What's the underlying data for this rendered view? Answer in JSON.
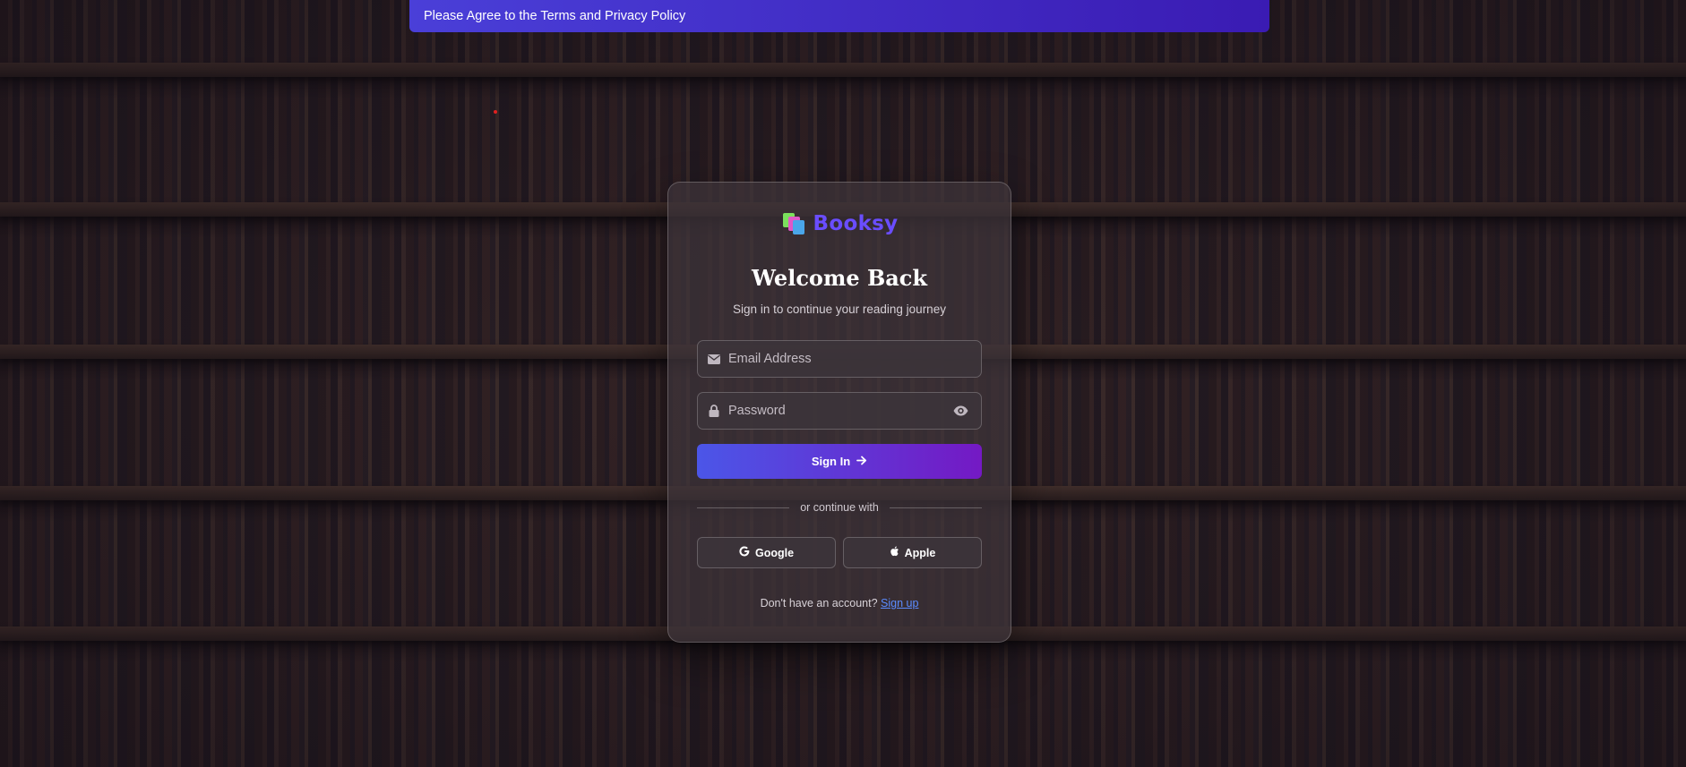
{
  "notice": {
    "text": "Please Agree to the Terms and Privacy Policy"
  },
  "brand": {
    "name": "Booksy",
    "icon": "books-stack-icon",
    "color": "#6a4dff"
  },
  "login": {
    "title": "Welcome Back",
    "subtitle": "Sign in to continue your reading journey",
    "email": {
      "placeholder": "Email Address",
      "value": "",
      "icon": "envelope-icon"
    },
    "password": {
      "placeholder": "Password",
      "value": "",
      "icon": "lock-icon",
      "toggle_icon": "eye-icon"
    },
    "signin_label": "Sign In",
    "divider_text": "or continue with",
    "social": {
      "google_label": "Google",
      "apple_label": "Apple"
    },
    "footer_text": "Don't have an account?",
    "signup_label": "Sign up"
  },
  "colors": {
    "notice_start": "#4a3fd8",
    "notice_end": "#3a1bb3",
    "signin_start": "#4b56e8",
    "signin_end": "#7419c4",
    "link": "#5b8cff"
  }
}
